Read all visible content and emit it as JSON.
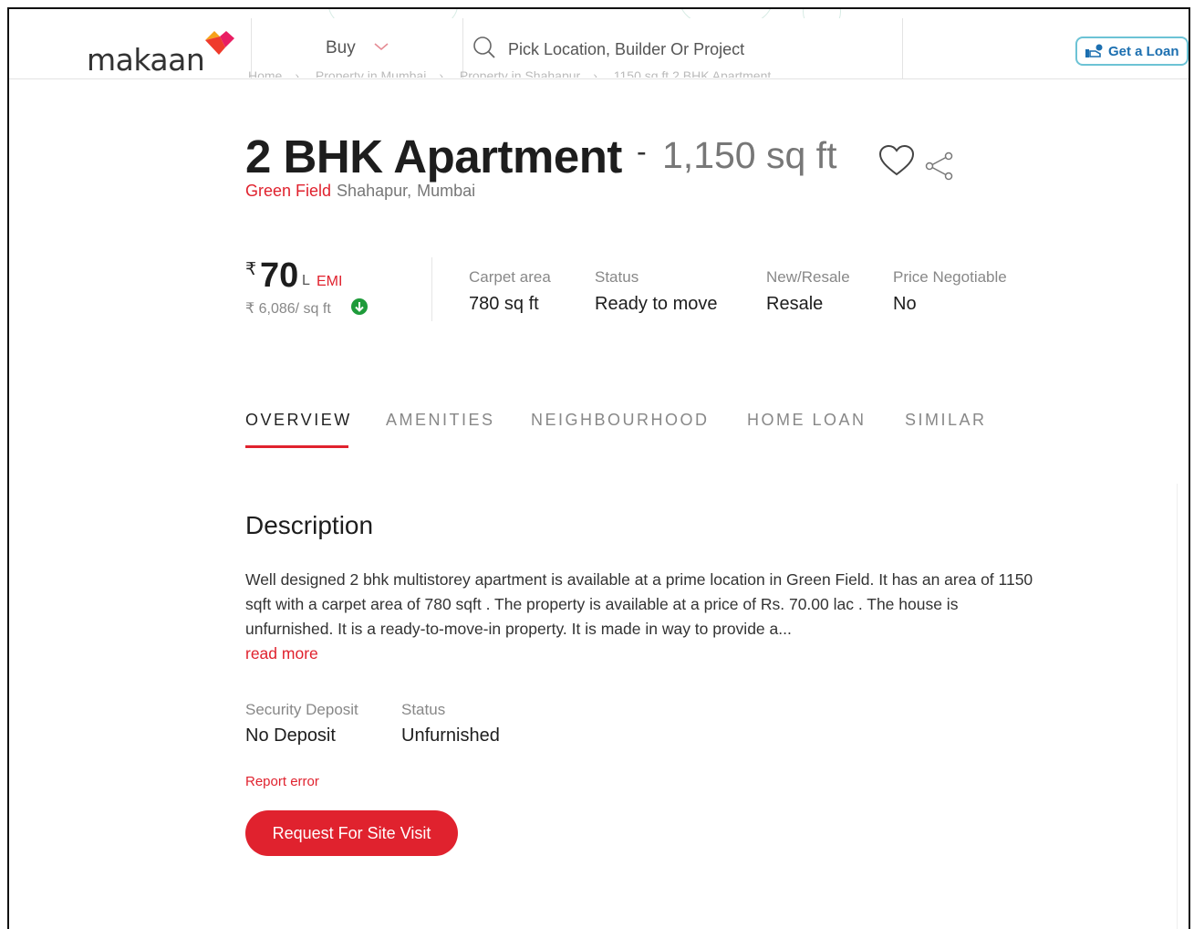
{
  "header": {
    "logo_text": "makaan",
    "buy_label": "Buy",
    "search_placeholder": "Pick Location, Builder Or Project",
    "loan_label": "Get a Loan"
  },
  "breadcrumb": [
    "Home",
    "Property in Mumbai",
    "Property in Shahapur",
    "1150 sq ft 2 BHK Apartment"
  ],
  "listing": {
    "title": "2 BHK Apartment",
    "dash": "-",
    "area": "1,150 sq ft",
    "project": "Green Field",
    "locality": "Shahapur,",
    "city": "Mumbai"
  },
  "price": {
    "currency": "₹",
    "amount": "70",
    "unit": "L",
    "emi": "EMI",
    "per_sqft": "₹ 6,086/ sq ft"
  },
  "stats": [
    {
      "label": "Carpet area",
      "value": "780 sq ft"
    },
    {
      "label": "Status",
      "value": "Ready to move"
    },
    {
      "label": "New/Resale",
      "value": "Resale"
    },
    {
      "label": "Price Negotiable",
      "value": "No"
    }
  ],
  "tabs": [
    "OVERVIEW",
    "AMENITIES",
    "NEIGHBOURHOOD",
    "HOME LOAN",
    "SIMILAR"
  ],
  "description": {
    "heading": "Description",
    "text": "Well designed 2 bhk multistorey apartment is available at a prime location in Green Field. It has an area of 1150 sqft with a carpet area of 780 sqft . The property is available at a price of Rs. 70.00 lac . The house is unfurnished. It is a ready-to-move-in property. It is made in way to provide a...",
    "read_more": "read more"
  },
  "details": [
    {
      "label": "Security Deposit",
      "value": "No Deposit"
    },
    {
      "label": "Status",
      "value": "Unfurnished"
    }
  ],
  "report_error": "Report error",
  "cta_label": "Request For Site Visit",
  "colors": {
    "accent": "#e0222e",
    "loan_border": "#6cc3d5",
    "price_down": "#1e9b3a"
  }
}
